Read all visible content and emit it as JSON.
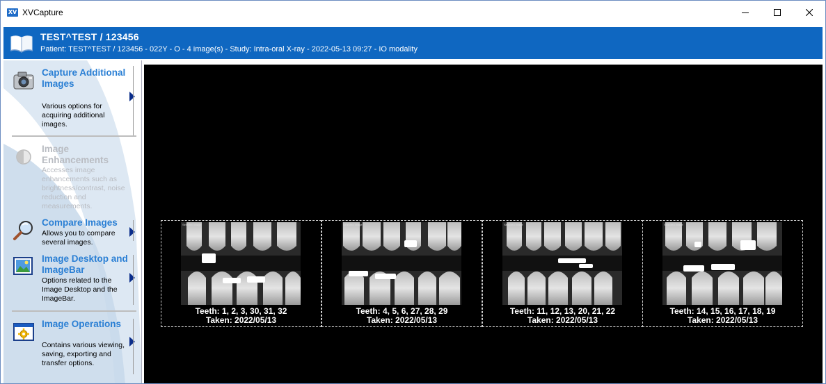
{
  "app": {
    "title": "XVCapture",
    "icon_text": "XV"
  },
  "window_controls": [
    "minimize-icon",
    "maximize-icon",
    "close-icon"
  ],
  "header": {
    "title": "TEST^TEST / 123456",
    "subtitle": "Patient: TEST^TEST / 123456  -  022Y  -  O  -  4 image(s)  -  Study: Intra-oral X-ray  -  2022-05-13 09:27  -  IO modality"
  },
  "sidebar": {
    "panels": [
      {
        "title": "Capture Additional Images",
        "desc": "Various options for acquiring additional images.",
        "icon": "camera-icon",
        "enabled": true
      },
      {
        "title": "Image Enhancements",
        "desc": "Accesses image enhancements such as brightness/contrast, noise reduction and measurements.",
        "icon": "contrast-icon",
        "enabled": false
      },
      {
        "title": "Compare Images",
        "desc": "Allows you to compare several images.",
        "icon": "magnifier-icon",
        "enabled": true
      },
      {
        "title": "Image Desktop and ImageBar",
        "desc": "Options related to the Image Desktop and the ImageBar.",
        "icon": "picture-icon",
        "enabled": true
      },
      {
        "title": "Image Operations",
        "desc": "Contains various viewing, saving, exporting and transfer options.",
        "icon": "gear-window-icon",
        "enabled": true
      }
    ]
  },
  "images": [
    {
      "label": "Selected image",
      "teeth": "Teeth: 1, 2, 3, 30, 31, 32",
      "taken": "Taken: 2022/05/13"
    },
    {
      "label": "Selected image",
      "teeth": "Teeth: 4, 5, 6, 27, 28, 29",
      "taken": "Taken: 2022/05/13"
    },
    {
      "label": "Selected image",
      "teeth": "Teeth: 11, 12, 13, 20, 21, 22",
      "taken": "Taken: 2022/05/13"
    },
    {
      "label": "Selected image",
      "teeth": "Teeth: 14, 15, 16, 17, 18, 19",
      "taken": "Taken: 2022/05/13"
    }
  ],
  "colors": {
    "header_bg": "#0f67c1",
    "panel_title": "#2a7fd4",
    "disabled": "#b9bcc2",
    "arrow": "#0a2d8a"
  }
}
